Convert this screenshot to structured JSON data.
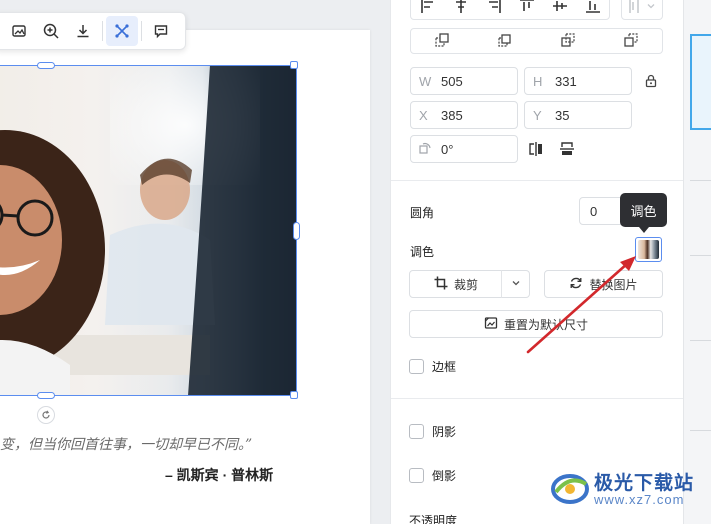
{
  "canvas": {
    "quote": "变，但当你回首往事，一切却早已不同。”",
    "author": "– 凯斯宾 · 普林斯"
  },
  "toolbar": {
    "icons": [
      "crop-image-icon",
      "zoom-in-icon",
      "download-icon",
      "magic-tool-icon",
      "comment-icon"
    ]
  },
  "panel": {
    "size": {
      "w_label": "W",
      "w_value": "505",
      "h_label": "H",
      "h_value": "331"
    },
    "position": {
      "x_label": "X",
      "x_value": "385",
      "y_label": "Y",
      "y_value": "35"
    },
    "rotation_value": "0°",
    "corner_label": "圆角",
    "corner_value": "0",
    "tone_label": "调色",
    "tooltip": "调色",
    "crop_button": "裁剪",
    "replace_button": "替换图片",
    "reset_button": "重置为默认尺寸",
    "border_label": "边框",
    "shadow_label": "阴影",
    "reflection_label": "倒影",
    "opacity_label": "不透明度"
  },
  "watermark": {
    "brand": "极光下载站",
    "url": "www.xz7.com"
  },
  "colors": {
    "accent": "#5b8def",
    "arrow": "#d2282c",
    "tooltip_bg": "#2e2f33"
  }
}
